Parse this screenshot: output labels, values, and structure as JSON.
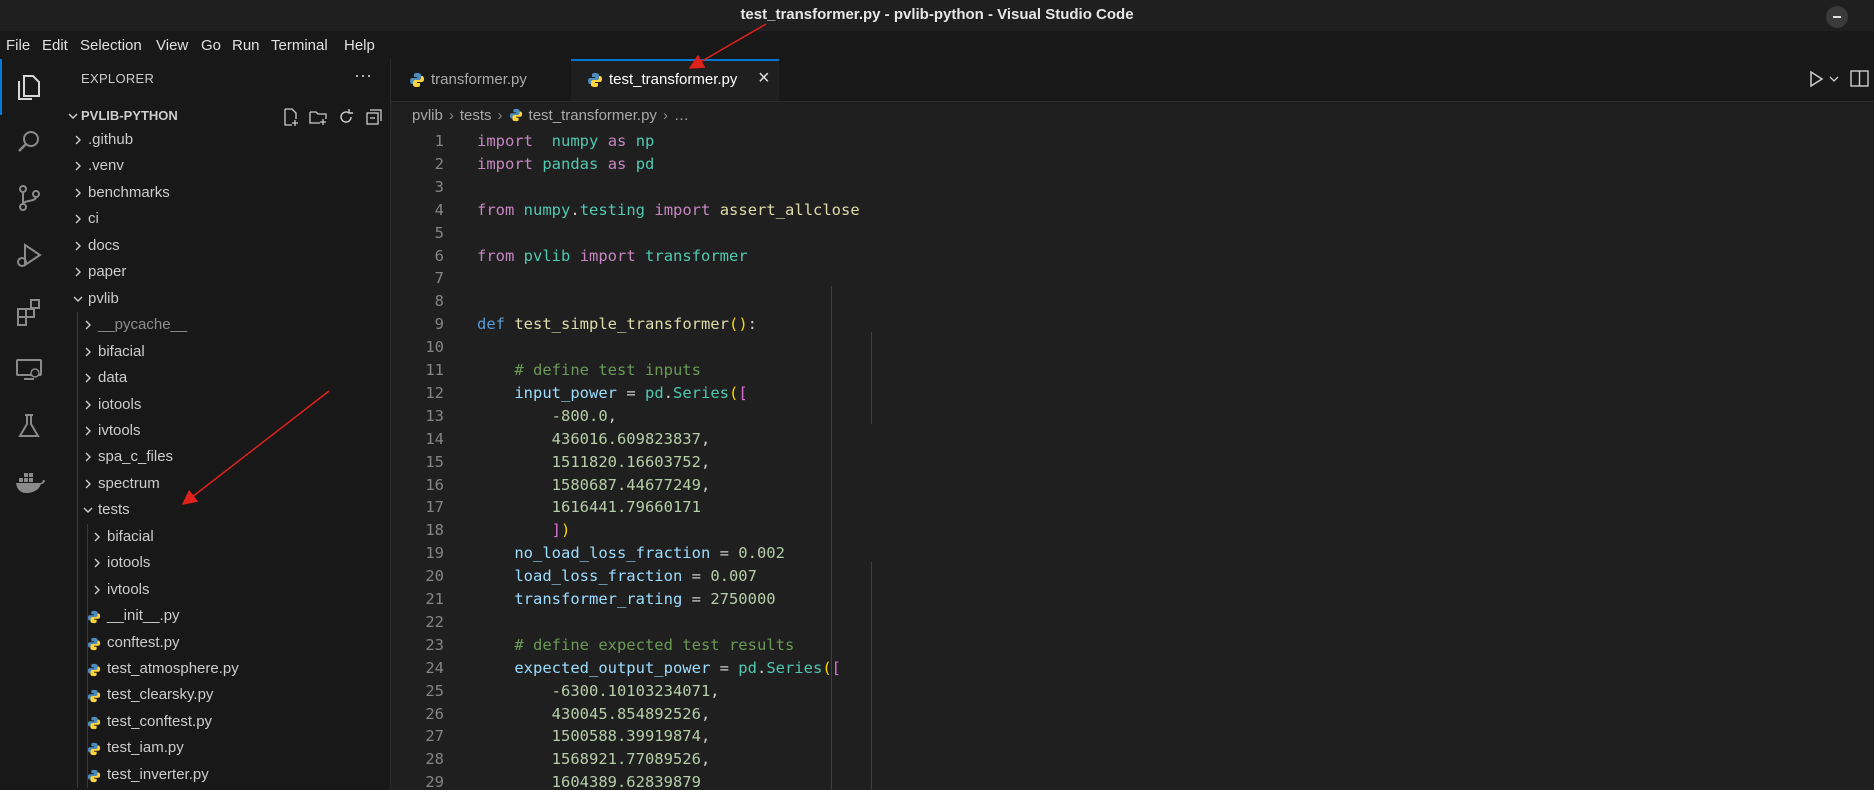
{
  "window": {
    "title": "test_transformer.py - pvlib-python - Visual Studio Code"
  },
  "menu": [
    "File",
    "Edit",
    "Selection",
    "View",
    "Go",
    "Run",
    "Terminal",
    "Help"
  ],
  "activity_icons": [
    "files-icon",
    "search-icon",
    "source-control-icon",
    "run-debug-icon",
    "extensions-icon",
    "remote-explorer-icon",
    "testing-icon",
    "docker-icon"
  ],
  "explorer": {
    "header": "EXPLORER",
    "more": "···",
    "root": "PVLIB-PYTHON",
    "items": [
      {
        "label": ".github",
        "type": "folder",
        "depth": 1,
        "open": false
      },
      {
        "label": ".venv",
        "type": "folder",
        "depth": 1,
        "open": false
      },
      {
        "label": "benchmarks",
        "type": "folder",
        "depth": 1,
        "open": false
      },
      {
        "label": "ci",
        "type": "folder",
        "depth": 1,
        "open": false
      },
      {
        "label": "docs",
        "type": "folder",
        "depth": 1,
        "open": false
      },
      {
        "label": "paper",
        "type": "folder",
        "depth": 1,
        "open": false
      },
      {
        "label": "pvlib",
        "type": "folder",
        "depth": 1,
        "open": true
      },
      {
        "label": "__pycache__",
        "type": "folder",
        "depth": 2,
        "open": false,
        "dim": true
      },
      {
        "label": "bifacial",
        "type": "folder",
        "depth": 2,
        "open": false
      },
      {
        "label": "data",
        "type": "folder",
        "depth": 2,
        "open": false
      },
      {
        "label": "iotools",
        "type": "folder",
        "depth": 2,
        "open": false
      },
      {
        "label": "ivtools",
        "type": "folder",
        "depth": 2,
        "open": false
      },
      {
        "label": "spa_c_files",
        "type": "folder",
        "depth": 2,
        "open": false
      },
      {
        "label": "spectrum",
        "type": "folder",
        "depth": 2,
        "open": false
      },
      {
        "label": "tests",
        "type": "folder",
        "depth": 2,
        "open": true
      },
      {
        "label": "bifacial",
        "type": "folder",
        "depth": 3,
        "open": false
      },
      {
        "label": "iotools",
        "type": "folder",
        "depth": 3,
        "open": false
      },
      {
        "label": "ivtools",
        "type": "folder",
        "depth": 3,
        "open": false
      },
      {
        "label": "__init__.py",
        "type": "file",
        "depth": 3
      },
      {
        "label": "conftest.py",
        "type": "file",
        "depth": 3
      },
      {
        "label": "test_atmosphere.py",
        "type": "file",
        "depth": 3
      },
      {
        "label": "test_clearsky.py",
        "type": "file",
        "depth": 3
      },
      {
        "label": "test_conftest.py",
        "type": "file",
        "depth": 3
      },
      {
        "label": "test_iam.py",
        "type": "file",
        "depth": 3
      },
      {
        "label": "test_inverter.py",
        "type": "file",
        "depth": 3
      }
    ]
  },
  "tabs": [
    {
      "label": "transformer.py",
      "active": false
    },
    {
      "label": "test_transformer.py",
      "active": true,
      "close": "×"
    }
  ],
  "breadcrumb": [
    "pvlib",
    "tests",
    "test_transformer.py",
    "…"
  ],
  "code_lines": [
    [
      [
        "kw",
        "import"
      ],
      [
        "",
        "  "
      ],
      [
        "mod",
        "numpy"
      ],
      [
        "",
        " "
      ],
      [
        "kw",
        "as"
      ],
      [
        "",
        " "
      ],
      [
        "mod",
        "np"
      ]
    ],
    [
      [
        "kw",
        "import"
      ],
      [
        "",
        " "
      ],
      [
        "mod",
        "pandas"
      ],
      [
        "",
        " "
      ],
      [
        "kw",
        "as"
      ],
      [
        "",
        " "
      ],
      [
        "mod",
        "pd"
      ]
    ],
    [],
    [
      [
        "kw",
        "from"
      ],
      [
        "",
        " "
      ],
      [
        "mod",
        "numpy"
      ],
      [
        "",
        "."
      ],
      [
        "mod",
        "testing"
      ],
      [
        "",
        " "
      ],
      [
        "kw",
        "import"
      ],
      [
        "",
        " "
      ],
      [
        "fn",
        "assert_allclose"
      ]
    ],
    [],
    [
      [
        "kw",
        "from"
      ],
      [
        "",
        " "
      ],
      [
        "mod",
        "pvlib"
      ],
      [
        "",
        " "
      ],
      [
        "kw",
        "import"
      ],
      [
        "",
        " "
      ],
      [
        "mod",
        "transformer"
      ]
    ],
    [],
    [],
    [
      [
        "kw2",
        "def"
      ],
      [
        "",
        " "
      ],
      [
        "fn",
        "test_simple_transformer"
      ],
      [
        "br1",
        "()"
      ],
      [
        "",
        ":"
      ]
    ],
    [],
    [
      [
        "",
        "    "
      ],
      [
        "com",
        "# define test inputs"
      ]
    ],
    [
      [
        "",
        "    "
      ],
      [
        "var",
        "input_power"
      ],
      [
        "",
        " = "
      ],
      [
        "mod",
        "pd"
      ],
      [
        "",
        "."
      ],
      [
        "mod",
        "Series"
      ],
      [
        "br1",
        "("
      ],
      [
        "br2",
        "["
      ]
    ],
    [
      [
        "",
        "        "
      ],
      [
        "num",
        "-800.0"
      ],
      [
        "",
        ","
      ]
    ],
    [
      [
        "",
        "        "
      ],
      [
        "num",
        "436016.609823837"
      ],
      [
        "",
        ","
      ]
    ],
    [
      [
        "",
        "        "
      ],
      [
        "num",
        "1511820.16603752"
      ],
      [
        "",
        ","
      ]
    ],
    [
      [
        "",
        "        "
      ],
      [
        "num",
        "1580687.44677249"
      ],
      [
        "",
        ","
      ]
    ],
    [
      [
        "",
        "        "
      ],
      [
        "num",
        "1616441.79660171"
      ]
    ],
    [
      [
        "",
        "        "
      ],
      [
        "br2",
        "]"
      ],
      [
        "br1",
        ")"
      ]
    ],
    [
      [
        "",
        "    "
      ],
      [
        "var",
        "no_load_loss_fraction"
      ],
      [
        "",
        " = "
      ],
      [
        "num",
        "0.002"
      ]
    ],
    [
      [
        "",
        "    "
      ],
      [
        "var",
        "load_loss_fraction"
      ],
      [
        "",
        " = "
      ],
      [
        "num",
        "0.007"
      ]
    ],
    [
      [
        "",
        "    "
      ],
      [
        "var",
        "transformer_rating"
      ],
      [
        "",
        " = "
      ],
      [
        "num",
        "2750000"
      ]
    ],
    [],
    [
      [
        "",
        "    "
      ],
      [
        "com",
        "# define expected test results"
      ]
    ],
    [
      [
        "",
        "    "
      ],
      [
        "var",
        "expected_output_power"
      ],
      [
        "",
        " = "
      ],
      [
        "mod",
        "pd"
      ],
      [
        "",
        "."
      ],
      [
        "mod",
        "Series"
      ],
      [
        "br1",
        "("
      ],
      [
        "br2",
        "["
      ]
    ],
    [
      [
        "",
        "        "
      ],
      [
        "num",
        "-6300.10103234071"
      ],
      [
        "",
        ","
      ]
    ],
    [
      [
        "",
        "        "
      ],
      [
        "num",
        "430045.854892526"
      ],
      [
        "",
        ","
      ]
    ],
    [
      [
        "",
        "        "
      ],
      [
        "num",
        "1500588.39919874"
      ],
      [
        "",
        ","
      ]
    ],
    [
      [
        "",
        "        "
      ],
      [
        "num",
        "1568921.77089526"
      ],
      [
        "",
        ","
      ]
    ],
    [
      [
        "",
        "        "
      ],
      [
        "num",
        "1604389.62839879"
      ]
    ]
  ]
}
